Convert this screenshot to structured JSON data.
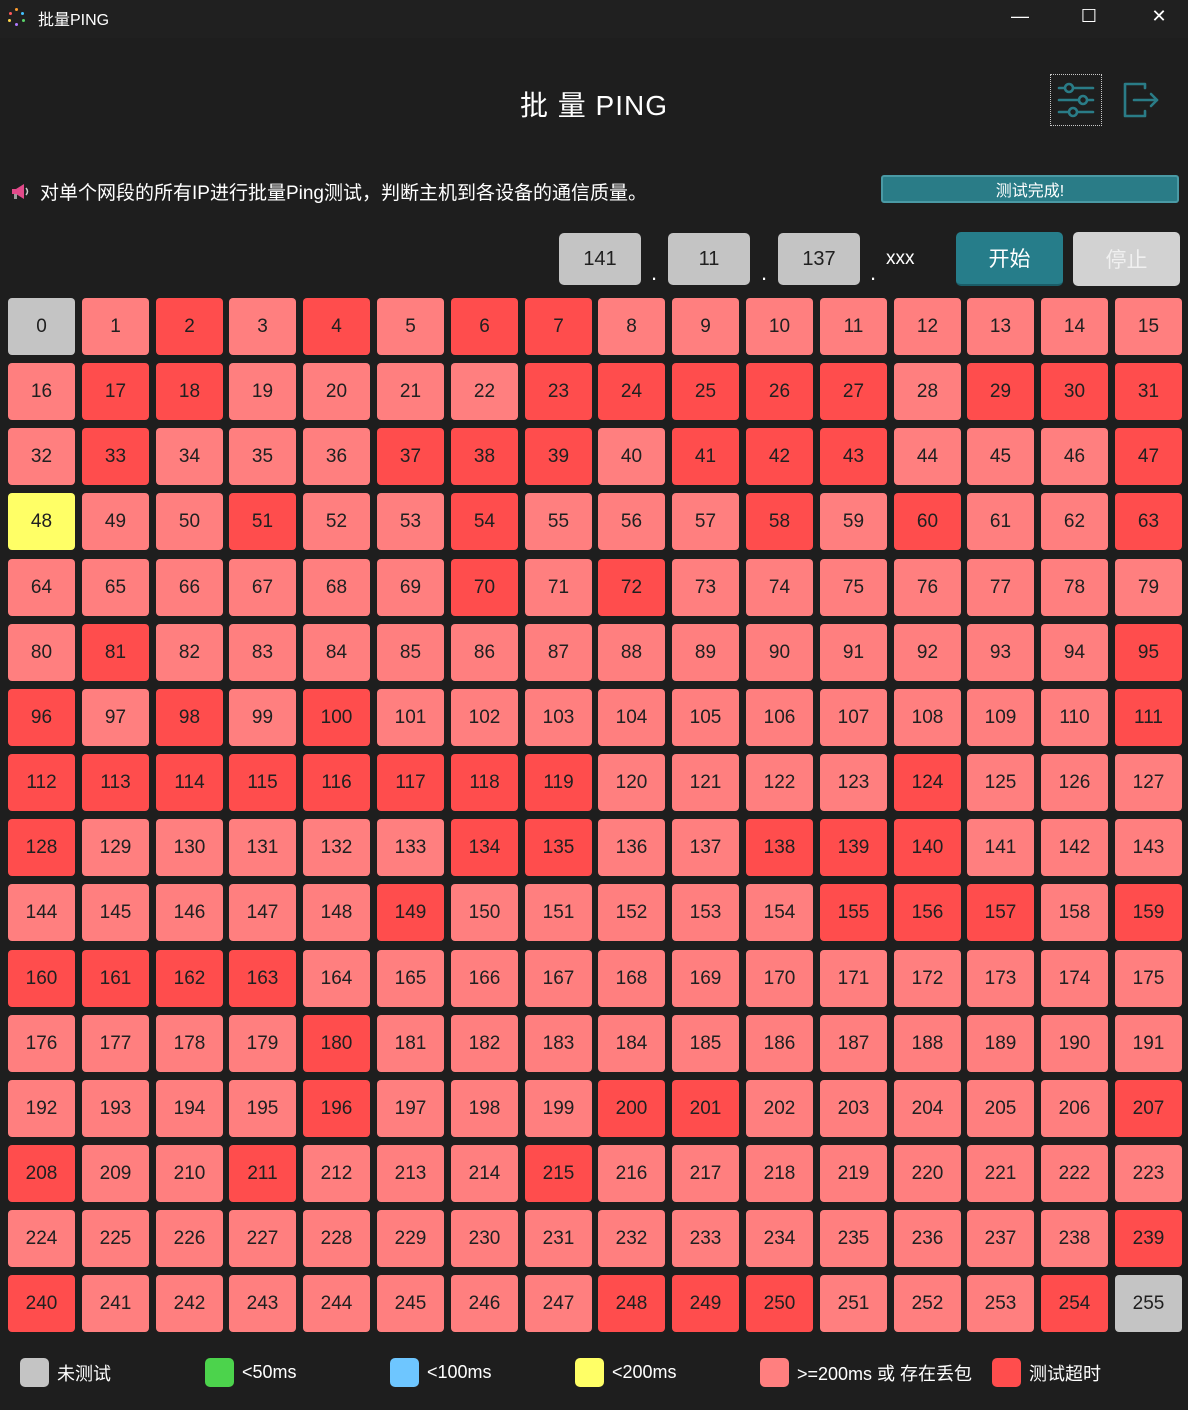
{
  "window": {
    "title": "批量PING",
    "minimize_glyph": "—",
    "maximize_glyph": "☐",
    "close_glyph": "✕"
  },
  "header": {
    "title": "批 量 PING",
    "settings_icon": "sliders-icon",
    "exit_icon": "exit-icon"
  },
  "description": "对单个网段的所有IP进行批量Ping测试，判断主机到各设备的通信质量。",
  "status": "测试完成!",
  "ip": {
    "octet1": "141",
    "octet2": "11",
    "octet3": "137",
    "suffix": "xxx",
    "separator": "."
  },
  "buttons": {
    "start": "开始",
    "stop": "停止"
  },
  "colors": {
    "untested": "#c4c4c4",
    "lt50": "#4cd34c",
    "lt100": "#6ec6ff",
    "lt200": "#ffff66",
    "slow": "#ff7f7f",
    "timeout": "#ff4d4d",
    "accent": "#267d8a"
  },
  "legend": [
    {
      "label": "未测试",
      "status": "untested"
    },
    {
      "label": "<50ms",
      "status": "lt50"
    },
    {
      "label": "<100ms",
      "status": "lt100"
    },
    {
      "label": "<200ms",
      "status": "lt200"
    },
    {
      "label": ">=200ms 或 存在丢包",
      "status": "slow"
    },
    {
      "label": "测试超时",
      "status": "timeout"
    }
  ],
  "hosts_status": "USTSTSTTSSSSSSSS STTSSSSTTTTTSTTT STSSSTTTSTTTSSST LSSTSSTSSSTSTSST SSSSSSTSTSSSSSSS STSSSSSSSSSSSSST TSTSTSSSSSSSSSST TTTTTTTTSSSSTSSS TSSSSSTTSSTTTSSS SSSSSTSSSSSTTTST TTTTSSSSSSSSSSSS SSSSTSSSSSSSSSSS SSSSTSSSTTSSSSST TSSTSSSTSSSSSSSS SSSSSSSSSSSSSSST TSSSSSSSTTTSSSTU"
}
